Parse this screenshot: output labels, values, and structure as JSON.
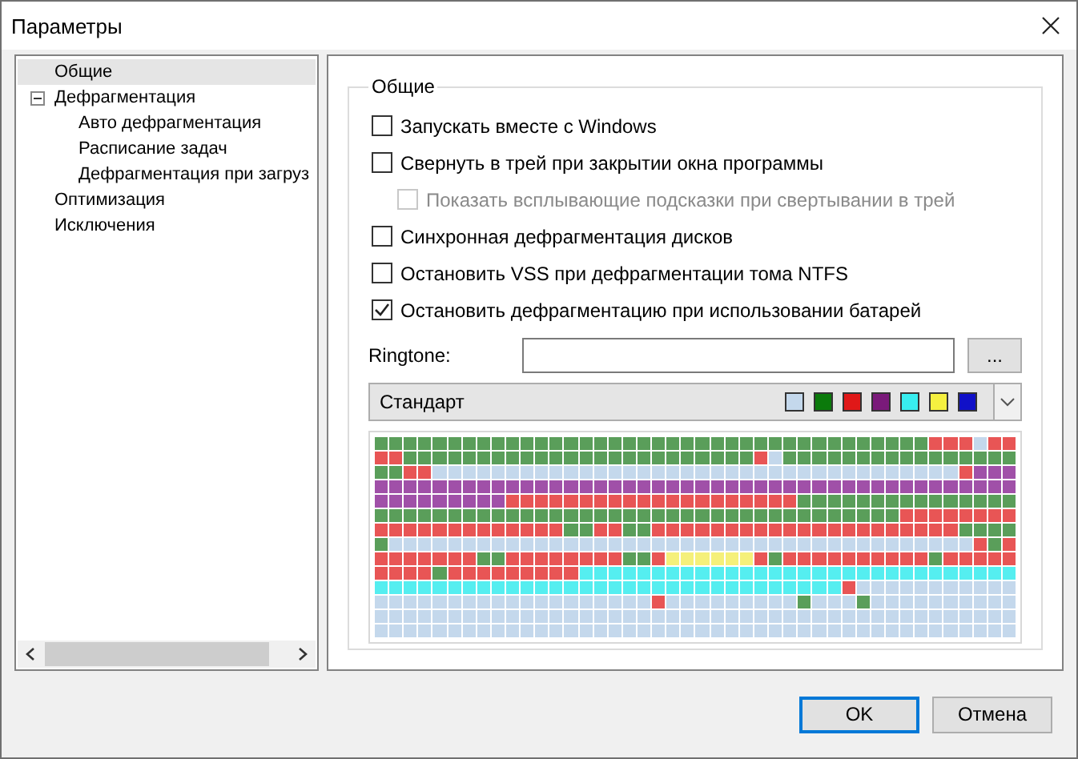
{
  "window": {
    "title": "Параметры"
  },
  "tree": [
    {
      "label": "Общие",
      "selected": true
    },
    {
      "label": "Дефрагментация",
      "selected": false,
      "expanded": true,
      "children": [
        {
          "label": "Авто дефрагментация",
          "selected": false
        },
        {
          "label": "Расписание задач",
          "selected": false
        },
        {
          "label": "Дефрагментация при загруз",
          "selected": false
        }
      ]
    },
    {
      "label": "Оптимизация",
      "selected": false
    },
    {
      "label": "Исключения",
      "selected": false
    }
  ],
  "group": {
    "title": "Общие",
    "options": [
      {
        "label": "Запускать вместе с Windows",
        "checked": false,
        "disabled": false
      },
      {
        "label": "Свернуть в трей при закрытии окна программы",
        "checked": false,
        "disabled": false,
        "children": [
          {
            "label": "Показать всплывающие подсказки при свертывании в трей",
            "checked": false,
            "disabled": true
          }
        ]
      },
      {
        "label": "Синхронная дефрагментация дисков",
        "checked": false,
        "disabled": false
      },
      {
        "label": "Остановить VSS при дефрагментации тома NTFS",
        "checked": false,
        "disabled": false
      },
      {
        "label": "Остановить дефрагментацию при использовании батарей",
        "checked": true,
        "disabled": false
      }
    ],
    "ringtone": {
      "label": "Ringtone:",
      "browse": "..."
    },
    "scheme": {
      "value": "Стандарт",
      "legend": [
        {
          "color": "#c4d8ec"
        },
        {
          "color": "#0b7a0b"
        },
        {
          "color": "#e01818"
        },
        {
          "color": "#7a1a7a"
        },
        {
          "color": "#38eef0"
        },
        {
          "color": "#f5f040"
        },
        {
          "color": "#1010c8"
        }
      ]
    }
  },
  "buttons": [
    {
      "label": "OK",
      "default": true
    },
    {
      "label": "Отмена",
      "default": false
    }
  ]
}
